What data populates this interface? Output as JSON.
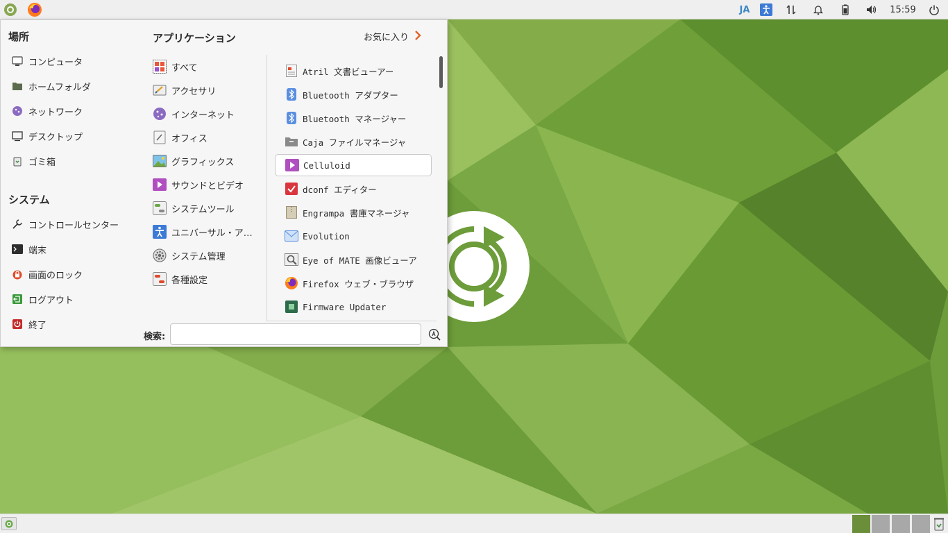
{
  "top_panel": {
    "keyboard_layout": "JA",
    "clock": "15:59",
    "icons": [
      "menu-logo-icon",
      "firefox-icon",
      "accessibility-icon",
      "network-icon",
      "notification-bell-icon",
      "battery-icon",
      "volume-icon",
      "power-icon"
    ]
  },
  "menu": {
    "places": {
      "title": "場所",
      "items": [
        {
          "label": "コンピュータ",
          "icon": "computer-icon"
        },
        {
          "label": "ホームフォルダ",
          "icon": "home-folder-icon"
        },
        {
          "label": "ネットワーク",
          "icon": "network-globe-icon"
        },
        {
          "label": "デスクトップ",
          "icon": "desktop-icon"
        },
        {
          "label": "ゴミ箱",
          "icon": "trash-icon"
        }
      ]
    },
    "system": {
      "title": "システム",
      "items": [
        {
          "label": "コントロールセンター",
          "icon": "wrench-icon"
        },
        {
          "label": "端末",
          "icon": "terminal-icon"
        },
        {
          "label": "画面のロック",
          "icon": "lock-icon"
        },
        {
          "label": "ログアウト",
          "icon": "logout-icon"
        },
        {
          "label": "終了",
          "icon": "shutdown-icon"
        }
      ]
    },
    "applications": {
      "title": "アプリケーション",
      "favorites_label": "お気に入り",
      "categories": [
        {
          "label": "すべて",
          "icon": "all-apps-icon"
        },
        {
          "label": "アクセサリ",
          "icon": "accessories-icon"
        },
        {
          "label": "インターネット",
          "icon": "internet-icon"
        },
        {
          "label": "オフィス",
          "icon": "office-icon"
        },
        {
          "label": "グラフィックス",
          "icon": "graphics-icon"
        },
        {
          "label": "サウンドとビデオ",
          "icon": "multimedia-icon"
        },
        {
          "label": "システムツール",
          "icon": "system-tools-icon"
        },
        {
          "label": "ユニバーサル・ア…",
          "icon": "universal-access-icon"
        },
        {
          "label": "システム管理",
          "icon": "administration-icon"
        },
        {
          "label": "各種設定",
          "icon": "preferences-icon"
        }
      ],
      "apps": [
        {
          "label": "Atril 文書ビューアー",
          "icon": "document-viewer-icon"
        },
        {
          "label": "Bluetooth アダプター",
          "icon": "bluetooth-icon"
        },
        {
          "label": "Bluetooth マネージャー",
          "icon": "bluetooth-icon"
        },
        {
          "label": "Caja ファイルマネージャ",
          "icon": "file-manager-icon"
        },
        {
          "label": "Celluloid",
          "icon": "celluloid-icon"
        },
        {
          "label": "dconf エディター",
          "icon": "dconf-editor-icon"
        },
        {
          "label": "Engrampa 書庫マネージャ",
          "icon": "archive-manager-icon"
        },
        {
          "label": "Evolution",
          "icon": "evolution-mail-icon"
        },
        {
          "label": "Eye of MATE 画像ビューア",
          "icon": "image-viewer-icon"
        },
        {
          "label": "Firefox ウェブ・ブラウザ",
          "icon": "firefox-icon"
        },
        {
          "label": "Firmware Updater",
          "icon": "firmware-chip-icon"
        }
      ],
      "selected_app_index": 4
    },
    "search": {
      "label": "検索:",
      "value": "",
      "placeholder": ""
    }
  },
  "bottom_panel": {
    "workspaces": 4,
    "active_workspace": 1
  }
}
